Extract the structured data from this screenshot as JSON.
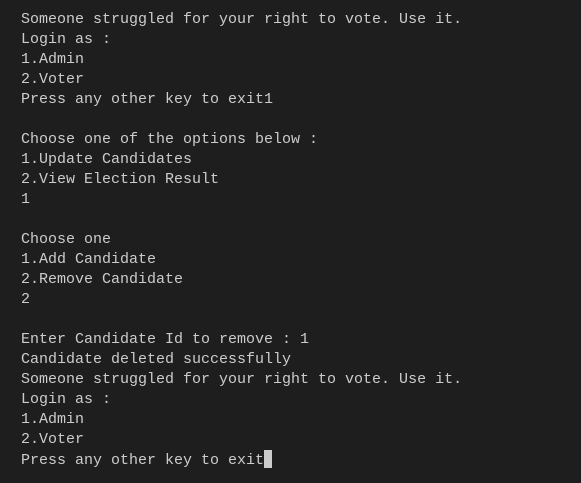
{
  "terminal": {
    "lines": [
      "Someone struggled for your right to vote. Use it.",
      "Login as :",
      "1.Admin",
      "2.Voter",
      "Press any other key to exit1",
      "",
      "Choose one of the options below :",
      "1.Update Candidates",
      "2.View Election Result",
      "1",
      "",
      "Choose one",
      "1.Add Candidate",
      "2.Remove Candidate",
      "2",
      "",
      "Enter Candidate Id to remove : 1",
      "Candidate deleted successfully",
      "Someone struggled for your right to vote. Use it.",
      "Login as :",
      "1.Admin",
      "2.Voter",
      "Press any other key to exit"
    ],
    "colors": {
      "background": "#1e1e1e",
      "text": "#cccccc"
    }
  }
}
